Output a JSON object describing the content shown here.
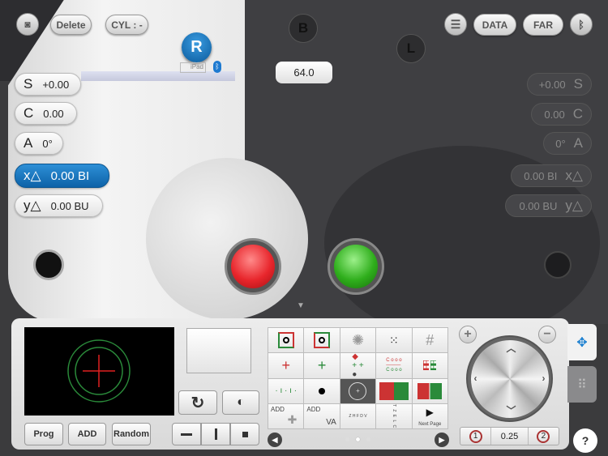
{
  "toolbar": {
    "view_icon": "eye-card-icon",
    "delete_label": "Delete",
    "cyl_label": "CYL : -",
    "list_icon": "list-icon",
    "data_label": "DATA",
    "far_label": "FAR",
    "bluetooth_icon": "bluetooth-icon"
  },
  "eyes": {
    "right_label": "R",
    "device_label": "iPad",
    "binocular_label": "B",
    "left_label": "L",
    "pd_value": "64.0"
  },
  "right_eye": {
    "S": {
      "label": "S",
      "value": "+0.00"
    },
    "C": {
      "label": "C",
      "value": "0.00"
    },
    "A": {
      "label": "A",
      "value": "0°"
    },
    "x": {
      "label": "x△",
      "value": "0.00 BI"
    },
    "y": {
      "label": "y△",
      "value": "0.00 BU"
    }
  },
  "left_eye": {
    "S": {
      "label": "S",
      "value": "+0.00"
    },
    "C": {
      "label": "C",
      "value": "0.00"
    },
    "A": {
      "label": "A",
      "value": "0°"
    },
    "x": {
      "label": "x△",
      "value": "0.00 BI"
    },
    "y": {
      "label": "y△",
      "value": "0.00 BU"
    }
  },
  "colors": {
    "accent": "#0d62a8",
    "red_button": "#e8262c",
    "green_button": "#2fae1c"
  },
  "controls": {
    "prog_label": "Prog",
    "add_label": "ADD",
    "random_label": "Random",
    "rotate_icon": "rotate-icon",
    "contrast_icon": "contrast-icon"
  },
  "charts": {
    "cells": [
      "",
      "",
      "",
      "",
      "",
      "",
      "",
      "",
      "",
      "",
      "",
      "",
      "",
      "",
      "",
      "ADD",
      "ADD",
      "Z H F D V",
      "T Z E L C",
      "Next Page"
    ],
    "va_label": "VA",
    "selected_index": 12,
    "page": 2,
    "pages": 3
  },
  "stepper": {
    "left": "1",
    "value": "0.25",
    "right": "2"
  },
  "help_label": "?"
}
